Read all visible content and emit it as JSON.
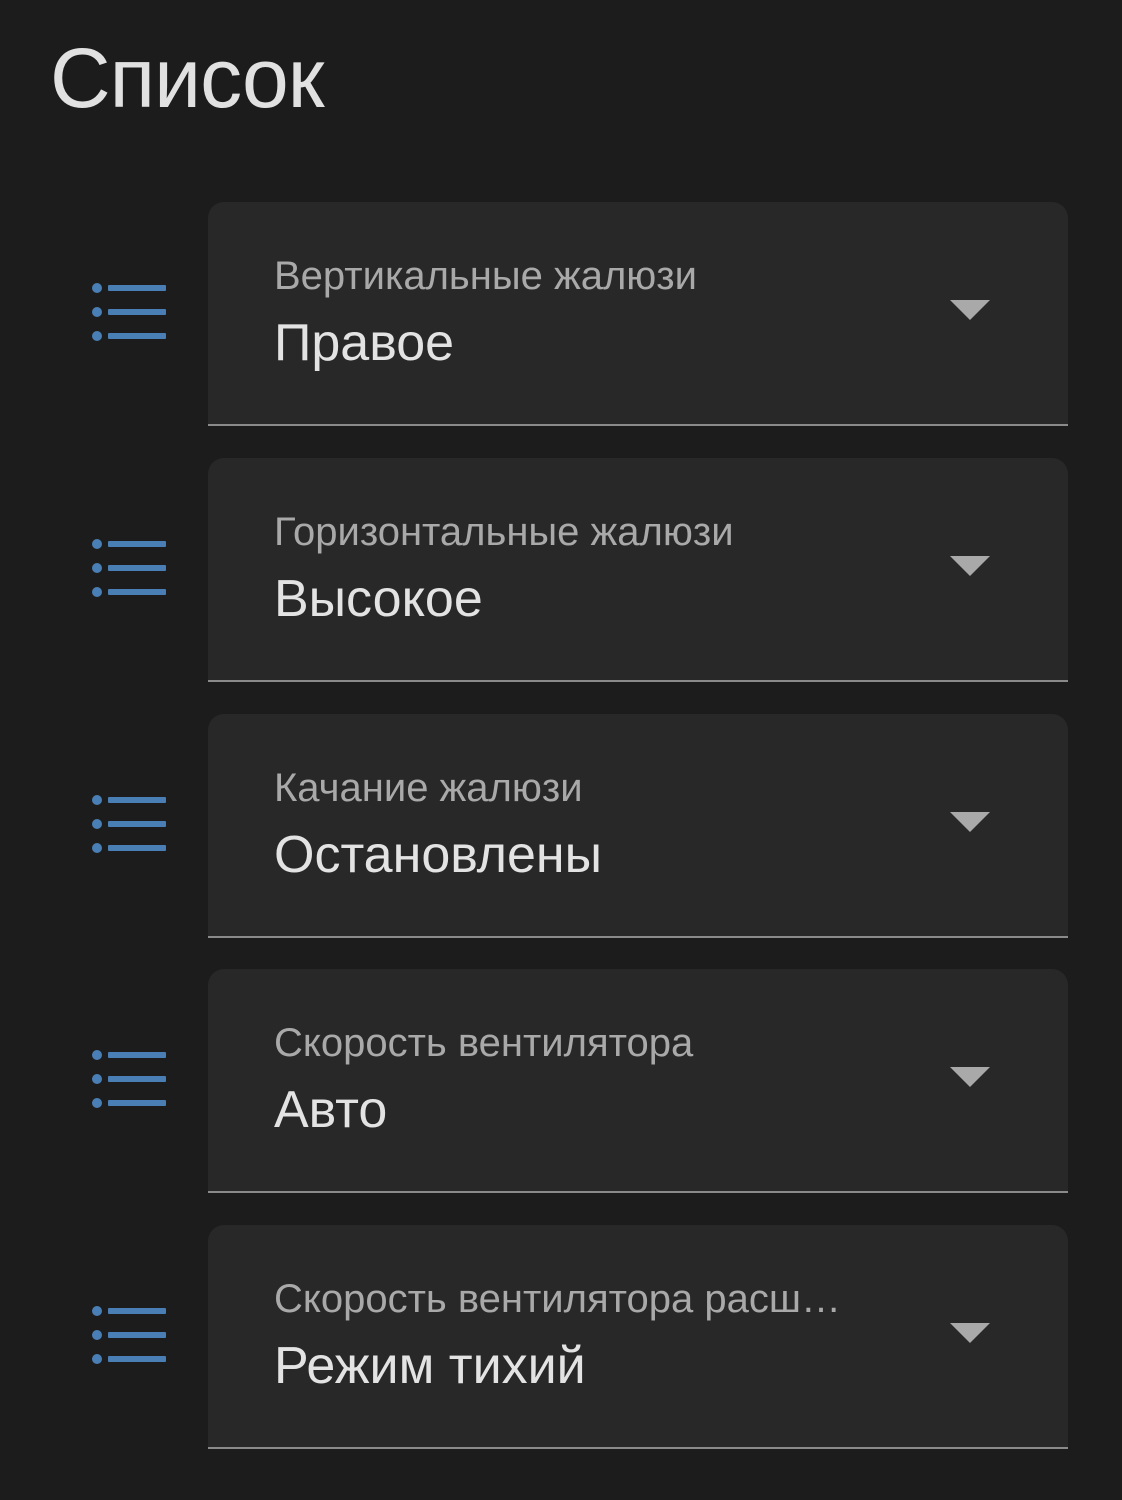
{
  "title": "Список",
  "icon": "format-list-bulleted-icon",
  "colors": {
    "background": "#1c1c1c",
    "field_background": "#282828",
    "icon_accent": "#4a7fb5",
    "label": "#a9a9a9",
    "value": "#e3e3e3"
  },
  "selects": [
    {
      "label": "Вертикальные жалюзи",
      "value": "Правое"
    },
    {
      "label": "Горизонтальные жалюзи",
      "value": "Высокое"
    },
    {
      "label": "Качание жалюзи",
      "value": "Остановлены"
    },
    {
      "label": "Скорость вентилятора",
      "value": "Авто"
    },
    {
      "label": "Скорость вентилятора расш…",
      "value": "Режим тихий"
    }
  ]
}
